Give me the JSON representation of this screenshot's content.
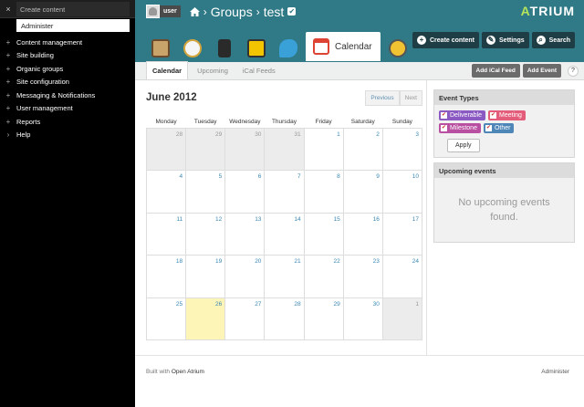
{
  "admin": {
    "close": "×",
    "create_content": "Create content",
    "administer": "Administer",
    "items": [
      {
        "pm": "+",
        "label": "Content management"
      },
      {
        "pm": "+",
        "label": "Site building"
      },
      {
        "pm": "+",
        "label": "Organic groups"
      },
      {
        "pm": "+",
        "label": "Site configuration"
      },
      {
        "pm": "+",
        "label": "Messaging & Notifications"
      },
      {
        "pm": "+",
        "label": "User management"
      },
      {
        "pm": "+",
        "label": "Reports"
      },
      {
        "pm": "›",
        "label": "Help"
      }
    ]
  },
  "header": {
    "user": "user",
    "breadcrumb": [
      "Groups",
      "test"
    ],
    "logo": "ATRIUM",
    "active_tab": "Calendar",
    "actions": [
      "Create content",
      "Settings",
      "Search"
    ],
    "colors": {
      "header": "#2f7a86",
      "accent": "#b6e45c"
    }
  },
  "subnav": {
    "tabs": [
      "Calendar",
      "Upcoming",
      "iCal Feeds"
    ],
    "add_ical": "Add iCal Feed",
    "add_event": "Add Event",
    "help": "?"
  },
  "calendar": {
    "title": "June 2012",
    "prev": "Previous",
    "next": "Next",
    "days": [
      "Monday",
      "Tuesday",
      "Wednesday",
      "Thursday",
      "Friday",
      "Saturday",
      "Sunday"
    ],
    "weeks": [
      [
        "28",
        "29",
        "30",
        "31",
        "1",
        "2",
        "3"
      ],
      [
        "4",
        "5",
        "6",
        "7",
        "8",
        "9",
        "10"
      ],
      [
        "11",
        "12",
        "13",
        "14",
        "15",
        "16",
        "17"
      ],
      [
        "18",
        "19",
        "20",
        "21",
        "22",
        "23",
        "24"
      ],
      [
        "25",
        "26",
        "27",
        "28",
        "29",
        "30",
        "1"
      ]
    ]
  },
  "event_types": {
    "title": "Event Types",
    "types": [
      {
        "label": "Deliverable",
        "color": "#8a5ac2"
      },
      {
        "label": "Meeting",
        "color": "#e35d7a"
      },
      {
        "label": "Milestone",
        "color": "#b94fa0"
      },
      {
        "label": "Other",
        "color": "#4f86b8"
      }
    ],
    "apply": "Apply"
  },
  "upcoming": {
    "title": "Upcoming events",
    "empty": "No upcoming events found."
  },
  "footer": {
    "built_with": "Built with",
    "link": "Open Atrium",
    "admin": "Administer"
  }
}
